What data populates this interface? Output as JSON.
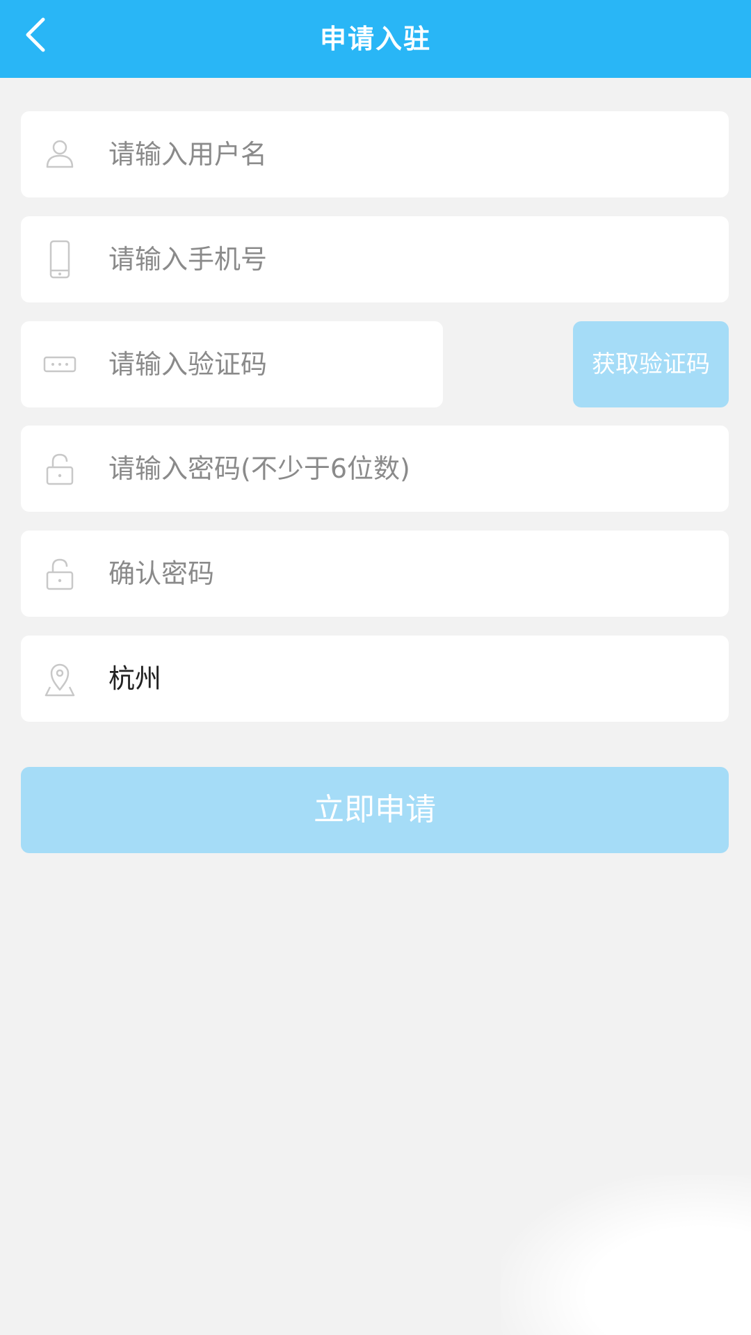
{
  "header": {
    "title": "申请入驻",
    "back_icon": "chevron-left-icon",
    "background": "#29b6f6"
  },
  "form": {
    "username": {
      "placeholder": "请输入用户名",
      "icon": "user-icon"
    },
    "phone": {
      "placeholder": "请输入手机号",
      "icon": "phone-icon"
    },
    "verification_code": {
      "placeholder": "请输入验证码",
      "icon": "code-icon"
    },
    "get_code_button": {
      "label": "获取验证码"
    },
    "password": {
      "placeholder": "请输入密码(不少于6位数)",
      "icon": "lock-icon"
    },
    "confirm_password": {
      "placeholder": "确认密码",
      "icon": "lock-icon"
    },
    "city": {
      "value": "杭州",
      "icon": "location-icon"
    }
  },
  "submit_button": {
    "label": "立即申请"
  },
  "colors": {
    "accent": "#29b6f6",
    "button_disabled": "#a5dcf7",
    "page_background": "#f2f2f2"
  }
}
